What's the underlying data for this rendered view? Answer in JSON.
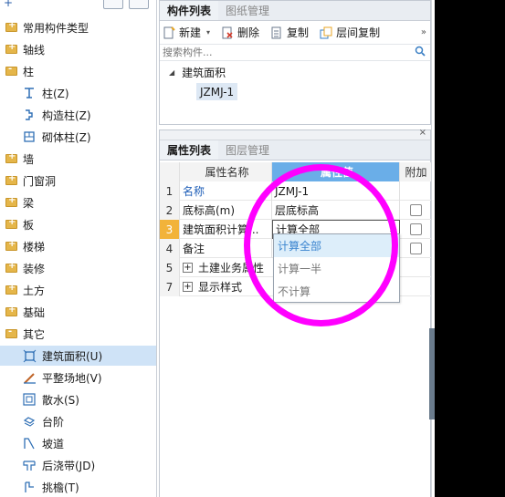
{
  "tree": {
    "items": [
      {
        "label": "常用构件类型",
        "kind": "folder",
        "state": "closed"
      },
      {
        "label": "轴线",
        "kind": "folder",
        "state": "closed"
      },
      {
        "label": "柱",
        "kind": "folder",
        "state": "open"
      },
      {
        "label": "柱(Z)",
        "kind": "child",
        "icon": "column-icon"
      },
      {
        "label": "构造柱(Z)",
        "kind": "child",
        "icon": "constructional-column-icon"
      },
      {
        "label": "砌体柱(Z)",
        "kind": "child",
        "icon": "masonry-column-icon"
      },
      {
        "label": "墙",
        "kind": "folder",
        "state": "closed"
      },
      {
        "label": "门窗洞",
        "kind": "folder",
        "state": "closed"
      },
      {
        "label": "梁",
        "kind": "folder",
        "state": "closed"
      },
      {
        "label": "板",
        "kind": "folder",
        "state": "closed"
      },
      {
        "label": "楼梯",
        "kind": "folder",
        "state": "closed"
      },
      {
        "label": "装修",
        "kind": "folder",
        "state": "closed"
      },
      {
        "label": "土方",
        "kind": "folder",
        "state": "closed"
      },
      {
        "label": "基础",
        "kind": "folder",
        "state": "closed"
      },
      {
        "label": "其它",
        "kind": "folder",
        "state": "open"
      },
      {
        "label": "建筑面积(U)",
        "kind": "child",
        "icon": "building-area-icon",
        "selected": true
      },
      {
        "label": "平整场地(V)",
        "kind": "child",
        "icon": "site-leveling-icon"
      },
      {
        "label": "散水(S)",
        "kind": "child",
        "icon": "apron-icon"
      },
      {
        "label": "台阶",
        "kind": "child",
        "icon": "steps-icon"
      },
      {
        "label": "坡道",
        "kind": "child",
        "icon": "ramp-icon"
      },
      {
        "label": "后浇带(JD)",
        "kind": "child",
        "icon": "post-cast-strip-icon"
      },
      {
        "label": "挑檐(T)",
        "kind": "child",
        "icon": "cornice-icon"
      }
    ]
  },
  "component_panel": {
    "tabs": [
      "构件列表",
      "图纸管理"
    ],
    "toolbar": {
      "new_label": "新建",
      "delete_label": "删除",
      "copy_label": "复制",
      "floor_copy_label": "层间复制"
    },
    "search_placeholder": "搜索构件...",
    "tree_root": "建筑面积",
    "tree_child": "JZMJ-1"
  },
  "property_panel": {
    "tabs": [
      "属性列表",
      "图层管理"
    ],
    "headers": {
      "name": "属性名称",
      "value": "属性值",
      "extra": "附加"
    },
    "rows": [
      {
        "num": "1",
        "name": "名称",
        "value": "JZMJ-1"
      },
      {
        "num": "2",
        "name": "底标高(m)",
        "value": "层底标高"
      },
      {
        "num": "3",
        "name": "建筑面积计算...",
        "value": "计算全部"
      },
      {
        "num": "4",
        "name": "备注",
        "value": ""
      },
      {
        "num": "5",
        "name": "土建业务属性",
        "value": ""
      },
      {
        "num": "7",
        "name": "显示样式",
        "value": ""
      }
    ],
    "dropdown_options": [
      "计算全部",
      "计算一半",
      "不计算"
    ]
  },
  "colors": {
    "accent": "#6aaee8",
    "annotation": "#ff00ff",
    "selection": "#cfe3f7",
    "row_marker": "#f2b33a"
  }
}
